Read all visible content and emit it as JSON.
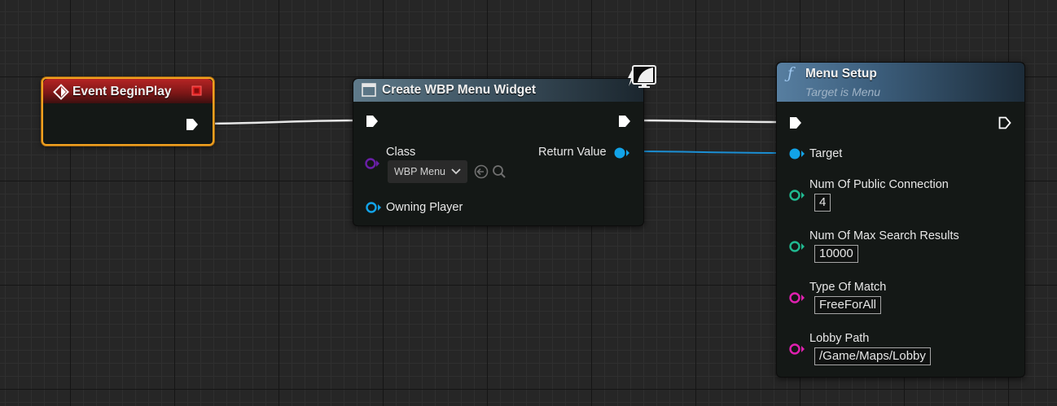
{
  "event_node": {
    "title": "Event BeginPlay"
  },
  "create_node": {
    "title": "Create WBP Menu Widget",
    "class_label": "Class",
    "class_value": "WBP Menu",
    "return_label": "Return Value",
    "owning_label": "Owning Player"
  },
  "menu_node": {
    "title": "Menu Setup",
    "subtitle": "Target is Menu",
    "pins": [
      {
        "label": "Target"
      },
      {
        "label": "Num Of Public Connection",
        "value": "4"
      },
      {
        "label": "Num Of Max Search Results",
        "value": "10000"
      },
      {
        "label": "Type Of Match",
        "value": "FreeForAll"
      },
      {
        "label": "Lobby Path",
        "value": "/Game/Maps/Lobby"
      }
    ]
  },
  "colors": {
    "exec_wire": "#e8e8e8",
    "object_wire": "#1b8fd4",
    "object_pin": "#12a3e8",
    "int_pin": "#20b890",
    "string_pin": "#e020b0",
    "class_pin": "#6a1fa8",
    "event_border": "#f0a020"
  }
}
